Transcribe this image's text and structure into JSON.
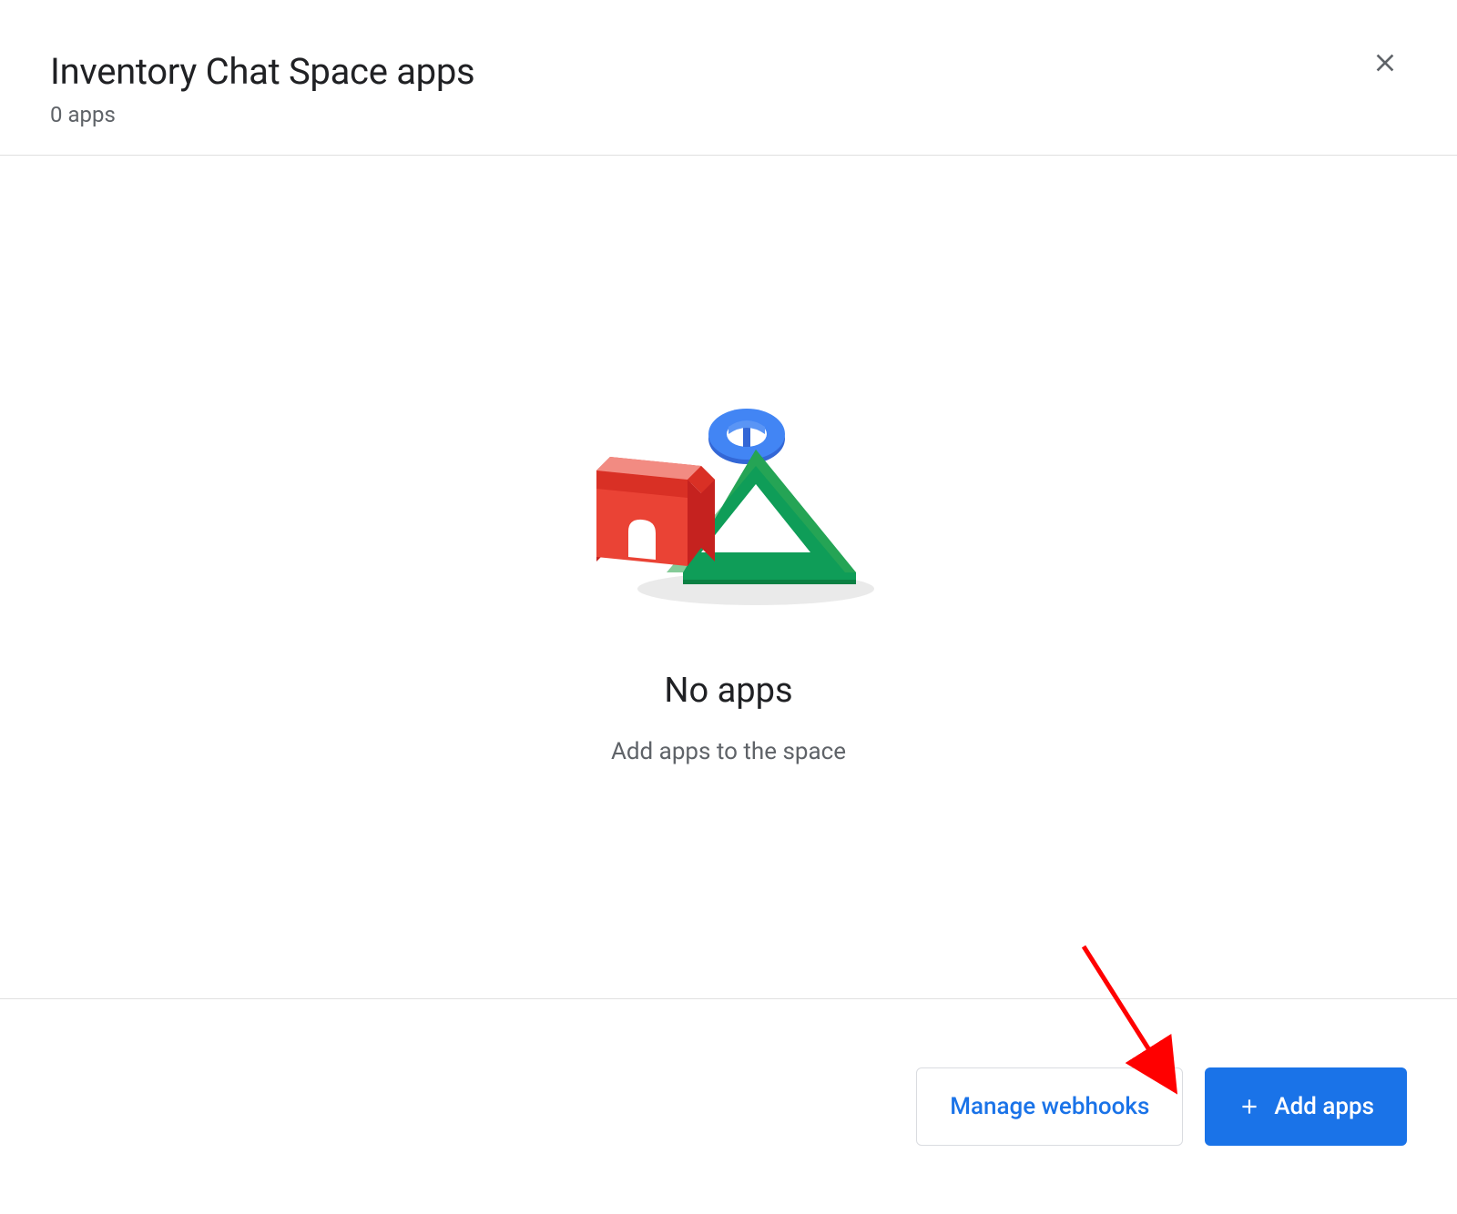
{
  "header": {
    "title": "Inventory Chat Space apps",
    "subtitle": "0 apps"
  },
  "empty_state": {
    "title": "No apps",
    "subtitle": "Add apps to the space"
  },
  "footer": {
    "manage_webhooks_label": "Manage webhooks",
    "add_apps_label": "Add apps"
  },
  "icons": {
    "close": "close-icon",
    "plus": "plus-icon"
  },
  "colors": {
    "primary": "#1a73e8",
    "text_primary": "#202124",
    "text_secondary": "#5f6368",
    "border": "#dadce0",
    "red": "#ea4335",
    "green": "#0f9d58",
    "blue": "#4285f4"
  }
}
